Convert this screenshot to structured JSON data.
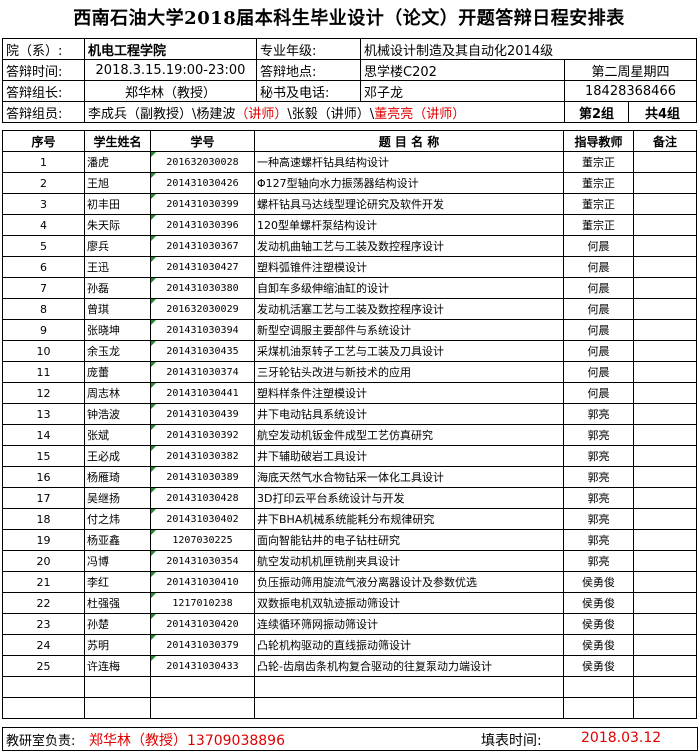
{
  "title": "西南石油大学2018届本科生毕业设计（论文）开题答辩日程安排表",
  "info": {
    "college_label": "院（系）:",
    "college": "机电工程学院",
    "major_label": "专业年级:",
    "major": "机械设计制造及其自动化2014级",
    "time_label": "答辩时间:",
    "time": "2018.3.15.19:00-23:00",
    "place_label": "答辩地点:",
    "place": "思学楼C202",
    "week": "第二周星期四",
    "leader_label": "答辩组长:",
    "leader": "郑华林（教授）",
    "secretary_label": "秘书及电话:",
    "secretary": "邓子龙",
    "phone": "18428368466",
    "members_label": "答辩组员:",
    "member1": "李成兵（副教授）\\",
    "member2_name": "杨建波",
    "member2_title": "（讲师）",
    "member3": "\\张毅（讲师）\\",
    "member4": "董亮亮（讲师）",
    "group": "第2组",
    "groups_total": "共4组"
  },
  "headers": {
    "seq": "序号",
    "name": "学生姓名",
    "id": "学号",
    "topic": "题 目 名 称",
    "advisor": "指导教师",
    "note": "备注"
  },
  "rows": [
    {
      "no": "1",
      "name": "潘虎",
      "id": "201632030028",
      "topic": "一种高速螺杆钻具结构设计",
      "advisor": "董宗正"
    },
    {
      "no": "2",
      "name": "王旭",
      "id": "201431030426",
      "topic": "Φ127型轴向水力振荡器结构设计",
      "advisor": "董宗正"
    },
    {
      "no": "3",
      "name": "初丰田",
      "id": "201431030399",
      "topic": "螺杆钻具马达线型理论研究及软件开发",
      "advisor": "董宗正"
    },
    {
      "no": "4",
      "name": "朱天际",
      "id": "201431030396",
      "topic": "120型单螺杆泵结构设计",
      "advisor": "董宗正"
    },
    {
      "no": "5",
      "name": "廖兵",
      "id": "201431030367",
      "topic": "发动机曲轴工艺与工装及数控程序设计",
      "advisor": "何晨"
    },
    {
      "no": "6",
      "name": "王迅",
      "id": "201431030427",
      "topic": "塑料弧锥件注塑模设计",
      "advisor": "何晨"
    },
    {
      "no": "7",
      "name": "孙磊",
      "id": "201431030380",
      "topic": "自卸车多级伸缩油缸的设计",
      "advisor": "何晨"
    },
    {
      "no": "8",
      "name": "曾琪",
      "id": "201632030029",
      "topic": "发动机活塞工艺与工装及数控程序设计",
      "advisor": "何晨"
    },
    {
      "no": "9",
      "name": "张晓坤",
      "id": "201431030394",
      "topic": "新型空调服主要部件与系统设计",
      "advisor": "何晨"
    },
    {
      "no": "10",
      "name": "余玉龙",
      "id": "201431030435",
      "topic": "采煤机油泵转子工艺与工装及刀具设计",
      "advisor": "何晨"
    },
    {
      "no": "11",
      "name": "庞蕾",
      "id": "201431030374",
      "topic": "三牙轮钻头改进与新技术的应用",
      "advisor": "何晨"
    },
    {
      "no": "12",
      "name": "周志林",
      "id": "201431030441",
      "topic": "塑料样条件注塑模设计",
      "advisor": "何晨"
    },
    {
      "no": "13",
      "name": "钟浩波",
      "id": "201431030439",
      "topic": "井下电动钻具系统设计",
      "advisor": "郭亮"
    },
    {
      "no": "14",
      "name": "张斌",
      "id": "201431030392",
      "topic": "航空发动机钣金件成型工艺仿真研究",
      "advisor": "郭亮"
    },
    {
      "no": "15",
      "name": "王必成",
      "id": "201431030382",
      "topic": "井下辅助破岩工具设计",
      "advisor": "郭亮"
    },
    {
      "no": "16",
      "name": "杨雁琦",
      "id": "201431030389",
      "topic": "海底天然气水合物钻采一体化工具设计",
      "advisor": "郭亮"
    },
    {
      "no": "17",
      "name": "吴继扬",
      "id": "201431030428",
      "topic": "3D打印云平台系统设计与开发",
      "advisor": "郭亮"
    },
    {
      "no": "18",
      "name": "付之炜",
      "id": "201431030402",
      "topic": "井下BHA机械系统能耗分布规律研究",
      "advisor": "郭亮"
    },
    {
      "no": "19",
      "name": "杨亚鑫",
      "id": "1207030225",
      "topic": "面向智能钻井的电子钻柱研究",
      "advisor": "郭亮"
    },
    {
      "no": "20",
      "name": "冯博",
      "id": "201431030354",
      "topic": "航空发动机机匣铣削夹具设计",
      "advisor": "郭亮"
    },
    {
      "no": "21",
      "name": "李红",
      "id": "201431030410",
      "topic": "负压振动筛用旋流气液分离器设计及参数优选",
      "advisor": "侯勇俊"
    },
    {
      "no": "22",
      "name": "杜强强",
      "id": "1217010238",
      "topic": "双数振电机双轨迹振动筛设计",
      "advisor": "侯勇俊"
    },
    {
      "no": "23",
      "name": "孙楚",
      "id": "201431030420",
      "topic": "连续循环筛网振动筛设计",
      "advisor": "侯勇俊"
    },
    {
      "no": "24",
      "name": "苏明",
      "id": "201431030379",
      "topic": "凸轮机构驱动的直线振动筛设计",
      "advisor": "侯勇俊"
    },
    {
      "no": "25",
      "name": "许连梅",
      "id": "201431030433",
      "topic": "凸轮-齿扇齿条机构复合驱动的往复泵动力端设计",
      "advisor": "侯勇俊"
    }
  ],
  "footer": {
    "dept_label": "教研室负责:",
    "dept_head": "郑华林（教授）13709038896",
    "date_label": "填表时间:",
    "date": "2018.03.12"
  }
}
